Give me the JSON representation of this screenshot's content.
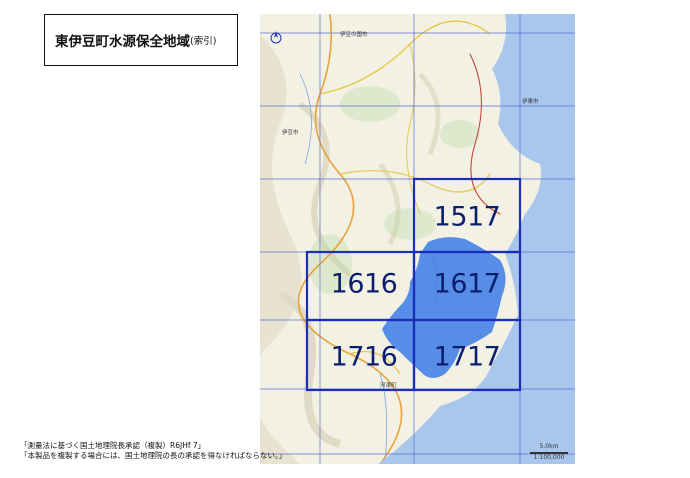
{
  "title": {
    "main": "東伊豆町水源保全地域",
    "sub": "(索引)"
  },
  "sheets": [
    {
      "id": "1517",
      "label": "1517"
    },
    {
      "id": "1616",
      "label": "1616"
    },
    {
      "id": "1617",
      "label": "1617"
    },
    {
      "id": "1716",
      "label": "1716"
    },
    {
      "id": "1717",
      "label": "1717"
    }
  ],
  "places": {
    "izu_no_kuni": "伊豆の国市",
    "izu_city": "伊豆市",
    "ito": "伊東市",
    "kawazu": "河津町"
  },
  "scale": {
    "distance": "5.0km",
    "ratio": "1:100,000"
  },
  "copyright": {
    "line1": "「測量法に基づく国土地理院長承認（複製）R6JHf 7」",
    "line2": "「本製品を複製する場合には、国土地理院の長の承認を得なければならない。」"
  },
  "colors": {
    "grid": "#5b6fd6",
    "index_border": "#1a2fb8",
    "conservation_area": "#3b7be8",
    "sea": "#a9c6ec",
    "land": "#f3f1e4",
    "label": "#0b1f6e"
  }
}
